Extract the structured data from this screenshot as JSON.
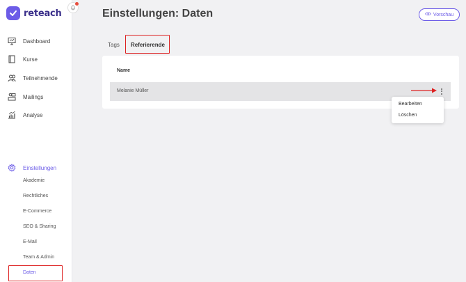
{
  "brand": {
    "name": "reteach",
    "color": "#6c5ce7"
  },
  "nav": {
    "items": [
      {
        "label": "Dashboard",
        "icon": "monitor-icon"
      },
      {
        "label": "Kurse",
        "icon": "book-icon"
      },
      {
        "label": "Teilnehmende",
        "icon": "users-icon"
      },
      {
        "label": "Mailings",
        "icon": "mailing-icon"
      },
      {
        "label": "Analyse",
        "icon": "chart-icon"
      }
    ],
    "settings": {
      "label": "Einstellungen",
      "sub_items": [
        "Akademie",
        "Rechtliches",
        "E-Commerce",
        "SEO & Sharing",
        "E-Mail",
        "Team & Admin",
        "Daten"
      ],
      "active_sub": "Daten"
    }
  },
  "header": {
    "title": "Einstellungen: Daten",
    "preview_label": "Vorschau"
  },
  "tabs": [
    {
      "label": "Tags"
    },
    {
      "label": "Referierende",
      "active": true
    }
  ],
  "table": {
    "columns": [
      "Name"
    ],
    "rows": [
      {
        "name": "Melanie Müller"
      }
    ]
  },
  "context_menu": {
    "items": [
      "Bearbeiten",
      "Löschen"
    ]
  },
  "colors": {
    "accent": "#6c5ce7",
    "highlight": "#dd2222",
    "notification": "#e74c3c"
  }
}
